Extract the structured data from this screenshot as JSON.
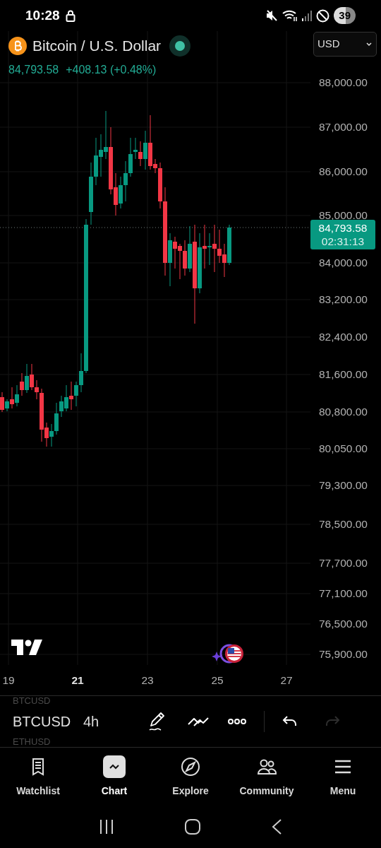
{
  "status_bar": {
    "time": "10:28",
    "battery": "39"
  },
  "header": {
    "title": "Bitcoin / U.S. Dollar",
    "market_open": true,
    "price": "84,793.58",
    "change": "+408.13 (+0.48%)",
    "currency": "USD"
  },
  "price_axis": [
    "88,000.00",
    "87,000.00",
    "86,000.00",
    "85,000.00",
    "84,000.00",
    "83,200.00",
    "82,400.00",
    "81,600.00",
    "80,800.00",
    "80,050.00",
    "79,300.00",
    "78,500.00",
    "77,700.00",
    "77,100.00",
    "76,500.00",
    "75,900.00"
  ],
  "last_price": {
    "price": "84,793.58",
    "countdown": "02:31:13"
  },
  "time_axis": [
    {
      "label": "19",
      "emphasized": false
    },
    {
      "label": "21",
      "emphasized": true
    },
    {
      "label": "23",
      "emphasized": false
    },
    {
      "label": "25",
      "emphasized": false
    },
    {
      "label": "27",
      "emphasized": false
    }
  ],
  "toolbar": {
    "symbols": [
      {
        "label": "BTCUSD",
        "selected": false
      },
      {
        "label": "BTCUSD",
        "selected": true
      },
      {
        "label": "ETHUSD",
        "selected": false
      }
    ],
    "interval": "4h",
    "tools": [
      {
        "kind": "draw",
        "disabled": false
      },
      {
        "kind": "patterns",
        "disabled": false
      },
      {
        "kind": "more",
        "disabled": false
      },
      {
        "kind": "undo",
        "disabled": false
      },
      {
        "kind": "redo",
        "disabled": true
      }
    ]
  },
  "nav": [
    {
      "label": "Watchlist",
      "kind": "watchlist",
      "selected": false
    },
    {
      "label": "Chart",
      "kind": "chart",
      "selected": true
    },
    {
      "label": "Explore",
      "kind": "explore",
      "selected": false
    },
    {
      "label": "Community",
      "kind": "community",
      "selected": false
    },
    {
      "label": "Menu",
      "kind": "menu",
      "selected": false
    }
  ]
}
